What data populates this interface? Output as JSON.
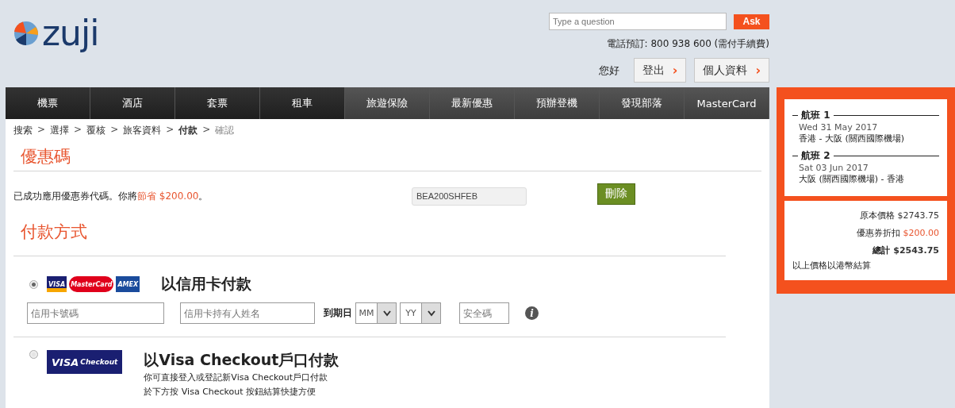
{
  "header": {
    "logo": "zuji",
    "search": {
      "placeholder": "Type a question"
    },
    "ask_button": "Ask",
    "phone": "電話預訂: 800 938 600 (需付手續費)",
    "greeting": "您好",
    "buttons": [
      {
        "label": "登出",
        "arrow": "›"
      },
      {
        "label": "個人資料",
        "arrow": "›"
      }
    ]
  },
  "nav": [
    {
      "label": "機票",
      "featured": false
    },
    {
      "label": "酒店",
      "featured": false
    },
    {
      "label": "套票",
      "featured": false
    },
    {
      "label": "租車",
      "featured": false
    },
    {
      "label": "旅遊保險",
      "featured": true
    },
    {
      "label": "最新優惠",
      "featured": true
    },
    {
      "label": "預辦登機",
      "featured": true
    },
    {
      "label": "發現部落",
      "featured": true
    },
    {
      "label": "MasterCard",
      "featured": true
    }
  ],
  "breadcrumb": [
    {
      "label": "搜索",
      "current": false,
      "disabled": false
    },
    {
      "prefix": ">",
      "label": "選擇",
      "current": false,
      "disabled": false
    },
    {
      "prefix": ">",
      "label": "覆核",
      "current": false,
      "disabled": false
    },
    {
      "prefix": ">",
      "label": "旅客資料",
      "current": false,
      "disabled": false
    },
    {
      "prefix": ">",
      "label": "付款",
      "current": true,
      "disabled": false
    },
    {
      "prefix": ">",
      "label": "確認",
      "current": false,
      "disabled": true
    }
  ],
  "promo": {
    "title": "優惠碼",
    "message_before": "已成功應用優惠券代碼。你將",
    "message_highlight": "節省 $200.00",
    "message_after": "。",
    "code": "BEA200SHFEB",
    "remove_button": "刪除"
  },
  "payment": {
    "title": "付款方式",
    "options": [
      {
        "kind": "card",
        "selected": true,
        "logos": [
          "VISA",
          "MasterCard",
          "AMEX"
        ],
        "title": "以信用卡付款",
        "card_number": {
          "placeholder": "信用卡號碼"
        },
        "holder": {
          "placeholder": "信用卡持有人姓名"
        },
        "expiry_label": "到期日",
        "month": "MM",
        "year": "YY",
        "cvv": {
          "placeholder": "安全碼"
        },
        "info": "i"
      },
      {
        "kind": "wallet",
        "selected": false,
        "logos": [
          "VISA",
          "Checkout"
        ],
        "title": "以Visa Checkout戶口付款",
        "description": [
          "你可直接登入或登記新Visa Checkout戶口付款",
          "於下方按 Visa Checkout 按鈕結算快捷方便"
        ]
      }
    ]
  },
  "summary": {
    "flights": [
      {
        "label": "航班 1",
        "date": "Wed 31 May 2017",
        "route": "香港 - 大阪 (關西國際機場)"
      },
      {
        "label": "航班 2",
        "date": "Sat 03 Jun 2017",
        "route": "大阪 (關西國際機場) - 香港"
      }
    ],
    "prices": [
      {
        "label": "原本價格",
        "value": "$2743.75",
        "kind": "normal"
      },
      {
        "label": "優惠券折扣",
        "value": "$200.00",
        "kind": "discount"
      },
      {
        "label": "總計",
        "value": "$2543.75",
        "kind": "total"
      }
    ],
    "note": "以上價格以港幣結算"
  }
}
